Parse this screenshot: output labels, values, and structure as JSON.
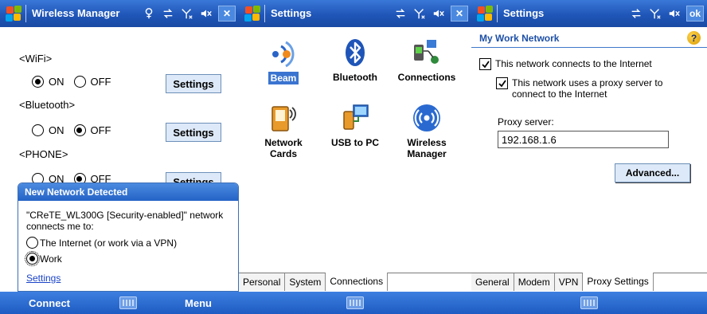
{
  "screen1": {
    "title": "Wireless Manager",
    "wifi_label": "<WiFi>",
    "bluetooth_label": "<Bluetooth>",
    "phone_label": "<PHONE>",
    "on_label": "ON",
    "off_label": "OFF",
    "settings_label": "Settings",
    "wifi_state": "ON",
    "bluetooth_state": "OFF",
    "phone_state": "OFF",
    "popup": {
      "title": "New Network Detected",
      "message": "\"CReTE_WL300G [Security-enabled]\" network connects me to:",
      "option_internet": "The Internet (or work via a VPN)",
      "option_work": "Work",
      "selected": "Work",
      "settings_link": "Settings"
    },
    "softkey_left": "Connect",
    "softkey_right": "Menu",
    "close_glyph": "✕"
  },
  "screen2": {
    "title": "Settings",
    "items": [
      {
        "label": "Beam",
        "icon": "beam-icon",
        "selected": true
      },
      {
        "label": "Bluetooth",
        "icon": "bluetooth-icon"
      },
      {
        "label": "Connections",
        "icon": "connections-icon"
      },
      {
        "label": "Network Cards",
        "label_line1": "Network",
        "label_line2": "Cards",
        "icon": "network-cards-icon"
      },
      {
        "label": "USB to PC",
        "icon": "usb-to-pc-icon"
      },
      {
        "label": "Wireless Manager",
        "label_line1": "Wireless",
        "label_line2": "Manager",
        "icon": "wireless-manager-icon"
      }
    ],
    "tabs": [
      "Personal",
      "System",
      "Connections"
    ],
    "active_tab": "Connections",
    "close_glyph": "✕"
  },
  "screen3": {
    "title": "Settings",
    "ok_label": "ok",
    "header": "My Work Network",
    "help_glyph": "?",
    "checkbox_internet": "This network connects to the Internet",
    "checkbox_proxy": "This network uses a proxy server to connect to the Internet",
    "proxy_label": "Proxy server:",
    "proxy_value": "192.168.1.6",
    "advanced_label": "Advanced...",
    "tabs": [
      "General",
      "Modem",
      "VPN",
      "Proxy Settings"
    ],
    "active_tab": "Proxy Settings"
  },
  "colors": {
    "titlebar": "#1f56b8",
    "accent": "#3a74d0",
    "link": "#1a43c8"
  }
}
